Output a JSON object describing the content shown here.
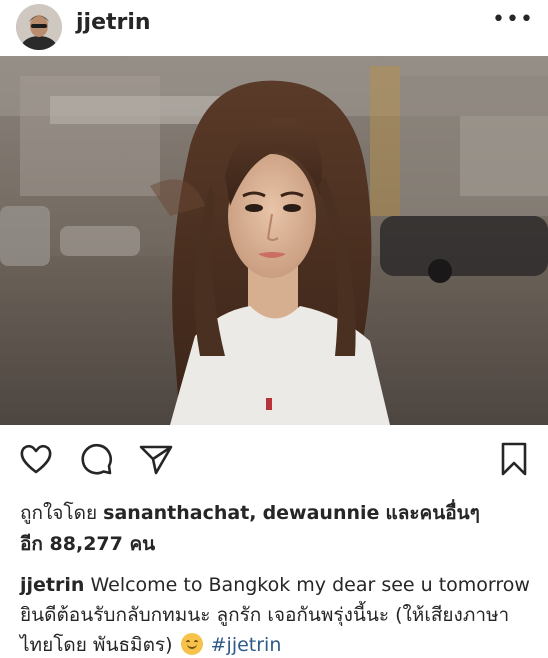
{
  "post": {
    "username": "jjetrin",
    "more_glyph": "•••"
  },
  "actions": {
    "like_icon": "heart-icon",
    "comment_icon": "comment-icon",
    "share_icon": "send-icon",
    "save_icon": "bookmark-icon"
  },
  "likes": {
    "prefix": "ถูกใจโดย",
    "user1": "sananthachat",
    "separator": ",",
    "user2": "dewaunnie",
    "and_others": "และคนอื่นๆ",
    "count_text": "อีก 88,277 คน"
  },
  "caption": {
    "username": "jjetrin",
    "text": "Welcome to Bangkok my dear  see u tomorrow ยินดีต้อนรับกลับกทมนะ ลูกรัก เจอกันพรุ่งนี้นะ (ให้เสียงภาษาไทยโดย พันธมิตร)",
    "hashtag": "#jjetrin"
  },
  "colors": {
    "text": "#262626",
    "hashtag": "#2e5a88"
  }
}
